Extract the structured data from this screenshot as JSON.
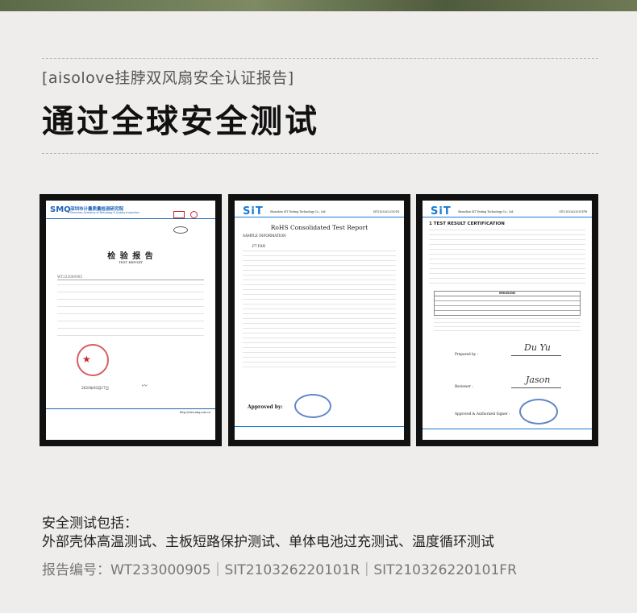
{
  "header": {
    "subtitle": "[aisolove挂脖双风扇安全认证报告]",
    "title": "通过全球安全测试"
  },
  "documents": [
    {
      "org": "深圳市计量质量检测研究院",
      "org_en": "Shenzhen Academy of Metrology & Quality Inspection",
      "doc_title": "检 验 报 告",
      "doc_title_en": "TEST REPORT",
      "report_no": "WT233000905",
      "date": "2023年03月17日",
      "website": "http://www.smq.com.cn"
    },
    {
      "org_en": "Shenzhen SIT Testing Technology Co., Ltd.",
      "doc_title": "RoHS Consolidated Test Report",
      "section": "SAMPLE INFORMATION",
      "sample": "F7 FAN",
      "approved_by": "Approved by:",
      "report_no": "SIT210326220101R"
    },
    {
      "org_en": "Shenzhen SIT Testing Technology Co., Ltd.",
      "doc_title": "1  TEST RESULT CERTIFICATION",
      "table_title": "EMISSION",
      "prepared_by": "Prepared by :",
      "reviewer": "Reviewer :",
      "approved": "Approved & Authorized Signer :",
      "report_no": "SIT210326220101FR"
    }
  ],
  "footer": {
    "label": "安全测试包括：",
    "tests": "外部壳体高温测试、主板短路保护测试、单体电池过充测试、温度循环测试",
    "report_numbers": "报告编号：WT233000905｜SIT210326220101R｜SIT210326220101FR"
  },
  "colors": {
    "background": "#eeedeb",
    "frame": "#111111",
    "smq_blue": "#1c62b8",
    "sit_blue": "#1a7bd4",
    "stamp_red": "#c8282d",
    "stamp_blue": "#2d5fb5"
  }
}
